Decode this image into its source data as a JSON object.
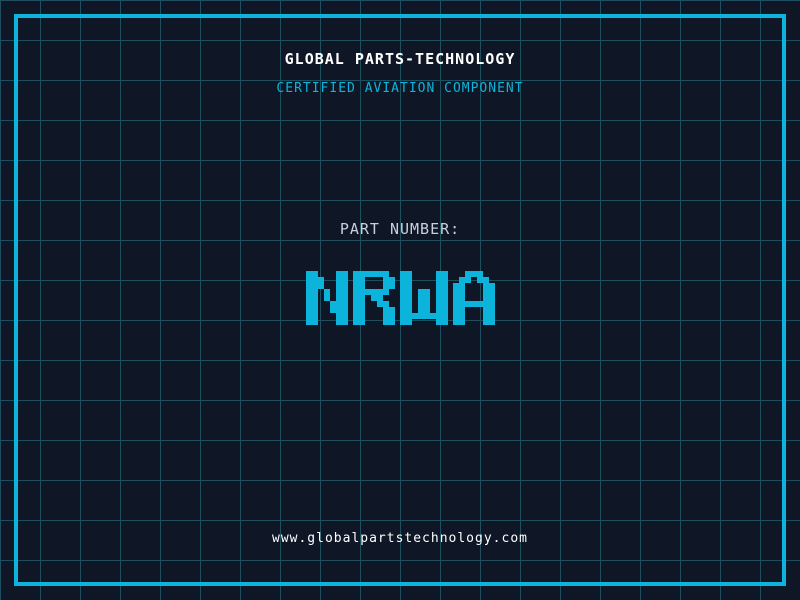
{
  "colors": {
    "background": "#0f1726",
    "grid_line": "#1d4f60",
    "accent": "#0cb4dc",
    "text_primary": "#ffffff",
    "text_muted": "#c9cfdb"
  },
  "header": {
    "company_name": "GLOBAL PARTS-TECHNOLOGY",
    "subtitle": "CERTIFIED AVIATION COMPONENT"
  },
  "part": {
    "label": "PART NUMBER:",
    "value": "NRWA"
  },
  "footer": {
    "website": "www.globalpartstechnology.com"
  }
}
